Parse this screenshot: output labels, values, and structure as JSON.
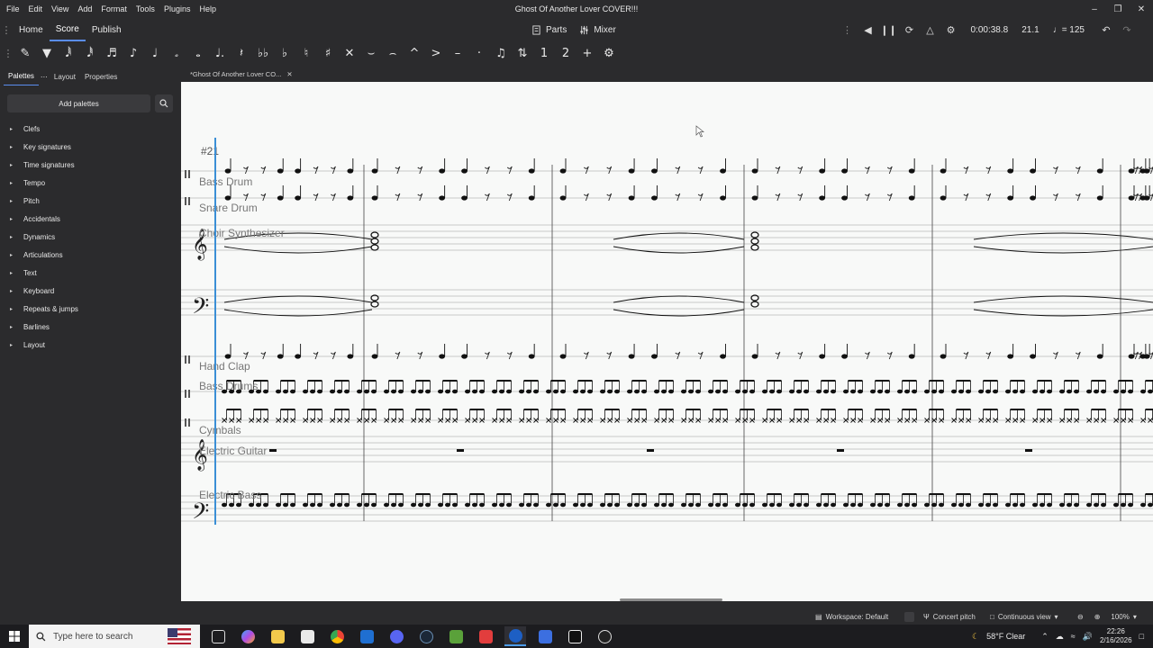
{
  "window": {
    "title": "Ghost Of Another Lover COVER!!!",
    "menus": [
      "File",
      "Edit",
      "View",
      "Add",
      "Format",
      "Tools",
      "Plugins",
      "Help"
    ]
  },
  "nav": {
    "tabs": [
      "Home",
      "Score",
      "Publish"
    ],
    "active_tab": "Score",
    "parts_label": "Parts",
    "mixer_label": "Mixer",
    "time": "0:00:38.8",
    "position": "21.1",
    "tempo": "♩= 125"
  },
  "toolbar_icons": [
    "pencil-icon",
    "input-mode-icon",
    "64th-note-icon",
    "32nd-note-icon",
    "16th-note-icon",
    "eighth-note-icon",
    "quarter-note-icon",
    "half-note-icon",
    "whole-note-icon",
    "augmentation-dot-icon",
    "rest-icon",
    "double-flat-icon",
    "flat-icon",
    "natural-icon",
    "sharp-icon",
    "double-sharp-icon",
    "tie-icon",
    "slur-icon",
    "marcato-icon",
    "accent-icon",
    "tenuto-icon",
    "staccato-icon",
    "tuplet-icon",
    "flip-direction-icon",
    "voice-1-icon",
    "voice-2-icon",
    "add-icon",
    "customize-icon"
  ],
  "left_panel": {
    "tabs": [
      "Palettes",
      "Layout",
      "Properties"
    ],
    "add_palettes_label": "Add palettes",
    "palettes": [
      "Clefs",
      "Key signatures",
      "Time signatures",
      "Tempo",
      "Pitch",
      "Accidentals",
      "Dynamics",
      "Articulations",
      "Text",
      "Keyboard",
      "Repeats & jumps",
      "Barlines",
      "Layout"
    ]
  },
  "score": {
    "doc_tab": "*Ghost Of Another Lover CO...",
    "measure_number": "#21",
    "instruments": [
      "Bass Drum",
      "Snare Drum",
      "Choir Synthesizer",
      "Hand Clap",
      "Bass Drums",
      "Cymbals",
      "Electric Guitar",
      "Electric Bass"
    ]
  },
  "statusbar": {
    "workspace": "Workspace: Default",
    "concert_pitch": "Concert pitch",
    "view_mode": "Continuous view",
    "zoom": "100%"
  },
  "taskbar": {
    "search_placeholder": "Type here to search",
    "weather": "58°F  Clear",
    "time": "22:26",
    "date": "2/16/2026"
  }
}
